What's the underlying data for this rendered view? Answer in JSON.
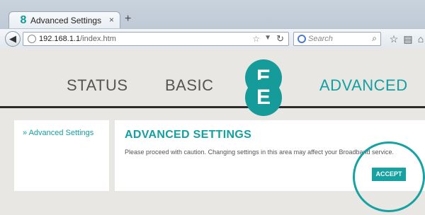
{
  "browser": {
    "tab_title": "Advanced Settings",
    "tab_favicon": "8",
    "tab_close": "×",
    "new_tab": "+",
    "url_host": "192.168.1.1",
    "url_path": "/index.htm",
    "search_placeholder": "Search",
    "icons": [
      "back-arrow-icon",
      "globe-icon",
      "star-icon",
      "reload-icon",
      "magnifier-icon",
      "bookmark-star-icon",
      "clipboard-icon",
      "home-icon",
      "menu-icon"
    ]
  },
  "header": {
    "nav": {
      "status": "STATUS",
      "basic": "BASIC",
      "advanced": "ADVANCED"
    },
    "logo": {
      "letter_top": "E",
      "letter_bottom": "E"
    },
    "colors": {
      "accent": "#169b9b",
      "nav_inactive": "#555555",
      "background": "#e9e7e3"
    }
  },
  "sidebar": {
    "items": [
      {
        "label": "» Advanced Settings"
      }
    ]
  },
  "main": {
    "title": "ADVANCED SETTINGS",
    "warning": "Please proceed with caution. Changing settings in this area may affect your Broadband service.",
    "accept_label": "ACCEPT"
  }
}
